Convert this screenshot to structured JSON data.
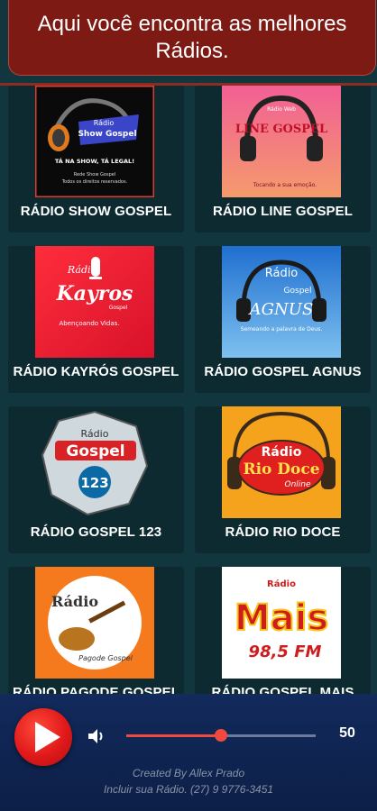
{
  "header": {
    "title": "Aqui você encontra as melhores Rádios."
  },
  "stations": [
    {
      "label": "RÁDIO SHOW GOSPEL",
      "logo": "logo-show-gospel",
      "logo_text": [
        "Rádio",
        "Show Gospel",
        "TÁ NA SHOW, TÁ LEGAL!",
        "Rede Show Gospel",
        "Todos os direitos reservados."
      ]
    },
    {
      "label": "RÁDIO LINE GOSPEL",
      "logo": "logo-line-gospel",
      "logo_text": [
        "Rádio Web",
        "LINE GOSPEL",
        "Tocando a sua emoção."
      ]
    },
    {
      "label": "RÁDIO KAYRÓS GOSPEL",
      "logo": "logo-kayros-gospel",
      "logo_text": [
        "Rádio",
        "Kayros",
        "Gospel",
        "Abençoando Vidas."
      ]
    },
    {
      "label": "RÁDIO GOSPEL AGNUS",
      "logo": "logo-gospel-agnus",
      "logo_text": [
        "Rádio",
        "Gospel",
        "AGNUS",
        "Semeando a palavra de Deus."
      ]
    },
    {
      "label": "RÁDIO GOSPEL 123",
      "logo": "logo-gospel-123",
      "logo_text": [
        "Rádio",
        "Gospel",
        "123"
      ]
    },
    {
      "label": "RÁDIO RIO DOCE",
      "logo": "logo-rio-doce",
      "logo_text": [
        "Rádio",
        "Rio Doce",
        "Online"
      ]
    },
    {
      "label": "RÁDIO PAGODE GOSPEL",
      "logo": "logo-pagode-gospel",
      "logo_text": [
        "Rádio",
        "Pagode Gospel"
      ]
    },
    {
      "label": "RÁDIO GOSPEL MAIS",
      "logo": "logo-mais-fm",
      "logo_text": [
        "Rádio",
        "Mais",
        "98,5 FM"
      ]
    }
  ],
  "player": {
    "volume": 50,
    "volume_label": "50",
    "credit_line1": "Created By Allex Prado",
    "credit_line2": "Incluir sua Rádio. (27) 9 9776-3451"
  },
  "colors": {
    "background": "#12363e",
    "header": "#7d1a14",
    "accent": "#f04a3e",
    "player": "#122a5c"
  }
}
